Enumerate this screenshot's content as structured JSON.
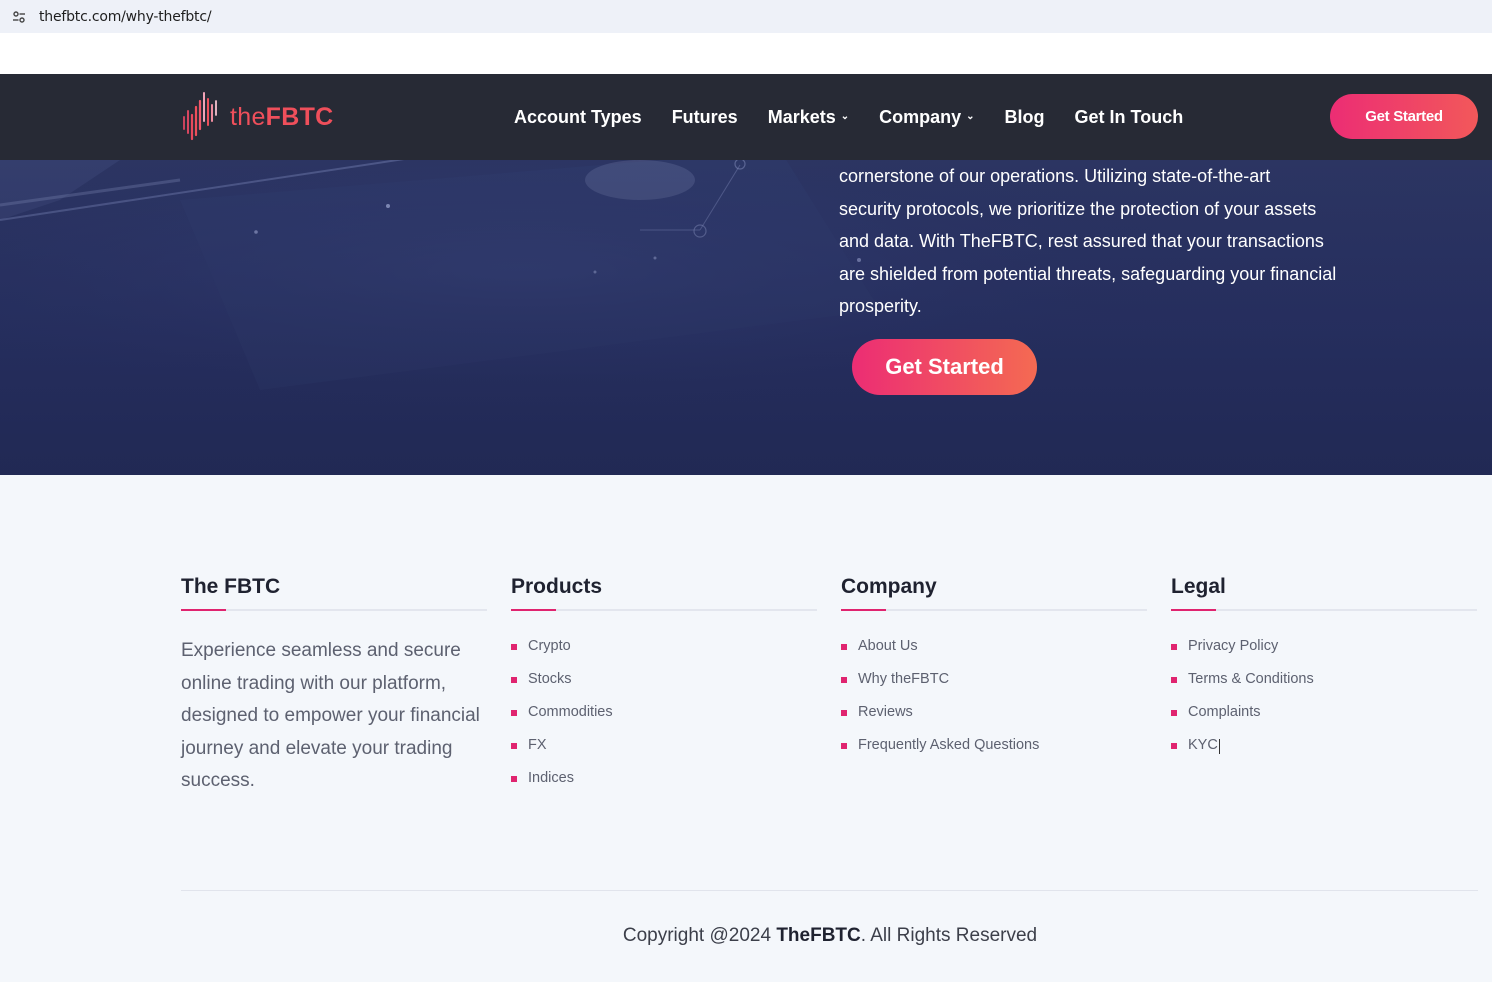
{
  "browser": {
    "url": "thefbtc.com/why-thefbtc/"
  },
  "header": {
    "logo_the": "the",
    "logo_fbtc": "FBTC",
    "nav": [
      {
        "label": "Account Types",
        "dropdown": false
      },
      {
        "label": "Futures",
        "dropdown": false
      },
      {
        "label": "Markets",
        "dropdown": true
      },
      {
        "label": "Company",
        "dropdown": true
      },
      {
        "label": "Blog",
        "dropdown": false
      },
      {
        "label": "Get In Touch",
        "dropdown": false
      }
    ],
    "cta_label": "Get Started"
  },
  "hero": {
    "lines": [
      "cornerstone of our operations. Utilizing state-of-the-art",
      "security protocols, we prioritize the protection of your assets",
      "and data. With TheFBTC, rest assured that your transactions",
      "are shielded from potential threats, safeguarding your financial",
      "prosperity."
    ],
    "cta_label": "Get Started"
  },
  "footer": {
    "about": {
      "title": "The FBTC",
      "text": "Experience seamless and secure online trading with our platform, designed to empower your financial journey and elevate your trading success."
    },
    "products": {
      "title": "Products",
      "links": [
        "Crypto",
        "Stocks",
        "Commodities",
        "FX",
        "Indices"
      ]
    },
    "company": {
      "title": "Company",
      "links": [
        "About Us",
        "Why theFBTC",
        "Reviews",
        "Frequently Asked Questions"
      ]
    },
    "legal": {
      "title": "Legal",
      "links": [
        "Privacy Policy",
        "Terms & Conditions",
        "Complaints",
        "KYC"
      ]
    },
    "copyright_prefix": "Copyright @2024 ",
    "copyright_brand": "TheFBTC",
    "copyright_suffix": ". All Rights Reserved"
  },
  "colors": {
    "accent_pink": "#e0246f",
    "header_bg": "#272a35",
    "hero_bg": "#283163",
    "logo_red": "#ef4f5b"
  }
}
